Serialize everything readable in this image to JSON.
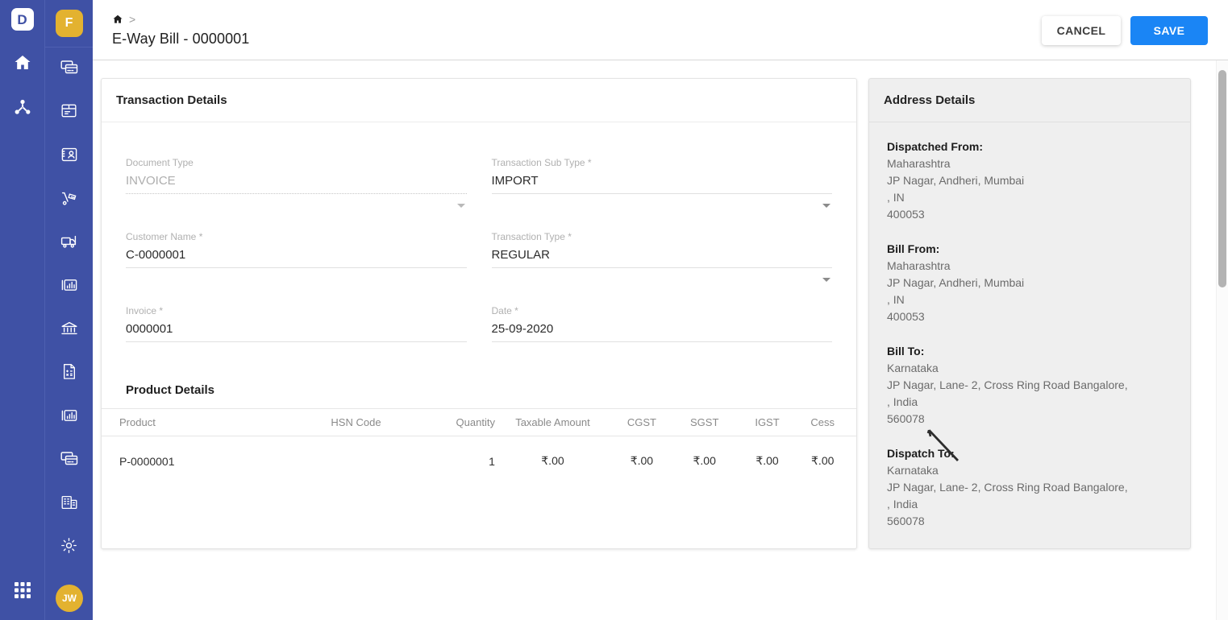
{
  "brand": {
    "logo_letter": "D",
    "workspace_avatar": "F",
    "user_avatar": "JW",
    "accent_blue": "#3f51a5",
    "accent_gold": "#e3b230",
    "primary_button": "#1a85f5"
  },
  "rail_outer": {
    "icons": [
      {
        "name": "home-icon",
        "label": "Home"
      },
      {
        "name": "sitemap-icon",
        "label": "Organization"
      }
    ],
    "apps_icon": {
      "name": "apps-grid-icon",
      "label": "Apps"
    }
  },
  "rail_inner": {
    "items": [
      {
        "name": "sidebar-item-billing",
        "icon": "cards-icon",
        "label": "Billing"
      },
      {
        "name": "sidebar-item-inventory",
        "icon": "box-icon",
        "label": "Inventory"
      },
      {
        "name": "sidebar-item-contacts",
        "icon": "contact-card-icon",
        "label": "Contacts"
      },
      {
        "name": "sidebar-item-dispatch",
        "icon": "hand-truck-icon",
        "label": "Dispatch"
      },
      {
        "name": "sidebar-item-delivery",
        "icon": "truck-icon",
        "label": "Delivery"
      },
      {
        "name": "sidebar-item-reports",
        "icon": "bar-chart-icon",
        "label": "Reports"
      },
      {
        "name": "sidebar-item-banking",
        "icon": "bank-icon",
        "label": "Banking"
      },
      {
        "name": "sidebar-item-accounting",
        "icon": "calculator-document-icon",
        "label": "Accounting"
      },
      {
        "name": "sidebar-item-analytics",
        "icon": "bar-chart-icon",
        "label": "Analytics"
      },
      {
        "name": "sidebar-item-payments",
        "icon": "cards-icon",
        "label": "Payments"
      },
      {
        "name": "sidebar-item-company",
        "icon": "building-icon",
        "label": "Company"
      },
      {
        "name": "sidebar-item-settings",
        "icon": "gear-icon",
        "label": "Settings"
      }
    ]
  },
  "header": {
    "breadcrumb_home": "⌂",
    "breadcrumb_separator": ">",
    "title": "E-Way Bill - 0000001",
    "cancel_label": "CANCEL",
    "save_label": "SAVE"
  },
  "transaction_card": {
    "title": "Transaction Details",
    "fields": [
      {
        "name": "document-type",
        "label": "Document Type",
        "value": "INVOICE",
        "type": "select",
        "disabled": true
      },
      {
        "name": "transaction-sub-type",
        "label": "Transaction Sub Type *",
        "value": "IMPORT",
        "type": "select",
        "disabled": false
      },
      {
        "name": "customer-name",
        "label": "Customer Name *",
        "value": "C-0000001",
        "type": "text",
        "disabled": false
      },
      {
        "name": "transaction-type",
        "label": "Transaction Type *",
        "value": "REGULAR",
        "type": "select",
        "disabled": false
      },
      {
        "name": "invoice",
        "label": "Invoice *",
        "value": "0000001",
        "type": "text",
        "disabled": false
      },
      {
        "name": "date",
        "label": "Date *",
        "value": "25-09-2020",
        "type": "text",
        "disabled": false
      }
    ]
  },
  "product_section": {
    "title": "Product Details",
    "columns": [
      "Product",
      "HSN Code",
      "Quantity",
      "Taxable Amount",
      "CGST",
      "SGST",
      "IGST",
      "Cess"
    ],
    "rows": [
      {
        "product": "P-0000001",
        "hsn_code": "",
        "quantity": "1",
        "taxable_amount": "₹.00",
        "cgst": "₹.00",
        "sgst": "₹.00",
        "igst": "₹.00",
        "cess": "₹.00"
      }
    ]
  },
  "address_card": {
    "title": "Address Details",
    "blocks": [
      {
        "name": "dispatched-from",
        "title": "Dispatched From:",
        "lines": [
          "Maharashtra",
          "JP Nagar, Andheri, Mumbai",
          ", IN",
          "400053"
        ]
      },
      {
        "name": "bill-from",
        "title": "Bill From:",
        "lines": [
          "Maharashtra",
          "JP Nagar, Andheri, Mumbai",
          ", IN",
          "400053"
        ]
      },
      {
        "name": "bill-to",
        "title": "Bill To:",
        "lines": [
          "Karnataka",
          "JP Nagar, Lane- 2, Cross Ring Road Bangalore,",
          ", India",
          "560078"
        ]
      },
      {
        "name": "dispatch-to",
        "title": "Dispatch To:",
        "lines": [
          "Karnataka",
          "JP Nagar, Lane- 2, Cross Ring Road Bangalore,",
          ", India",
          "560078"
        ]
      }
    ]
  }
}
